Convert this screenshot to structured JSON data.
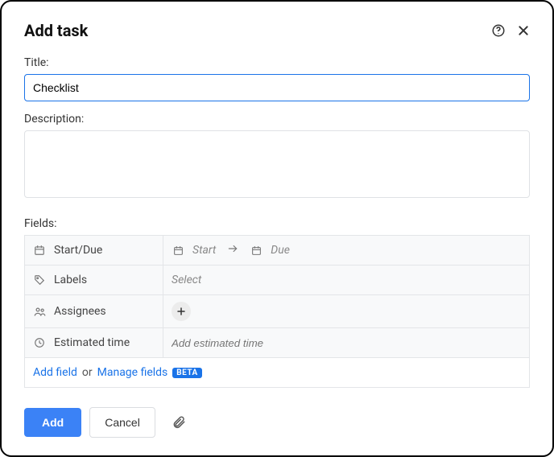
{
  "header": {
    "title": "Add task"
  },
  "form": {
    "title_label": "Title:",
    "title_value": "Checklist",
    "description_label": "Description:",
    "description_value": ""
  },
  "fields": {
    "section_label": "Fields:",
    "rows": {
      "start_due": {
        "label": "Start/Due",
        "start_placeholder": "Start",
        "due_placeholder": "Due"
      },
      "labels": {
        "label": "Labels",
        "placeholder": "Select"
      },
      "assignees": {
        "label": "Assignees"
      },
      "estimated": {
        "label": "Estimated time",
        "placeholder": "Add estimated time"
      }
    },
    "add_row": {
      "add_field": "Add field",
      "or": "or",
      "manage_fields": "Manage fields",
      "beta": "BETA"
    }
  },
  "footer": {
    "add": "Add",
    "cancel": "Cancel"
  }
}
